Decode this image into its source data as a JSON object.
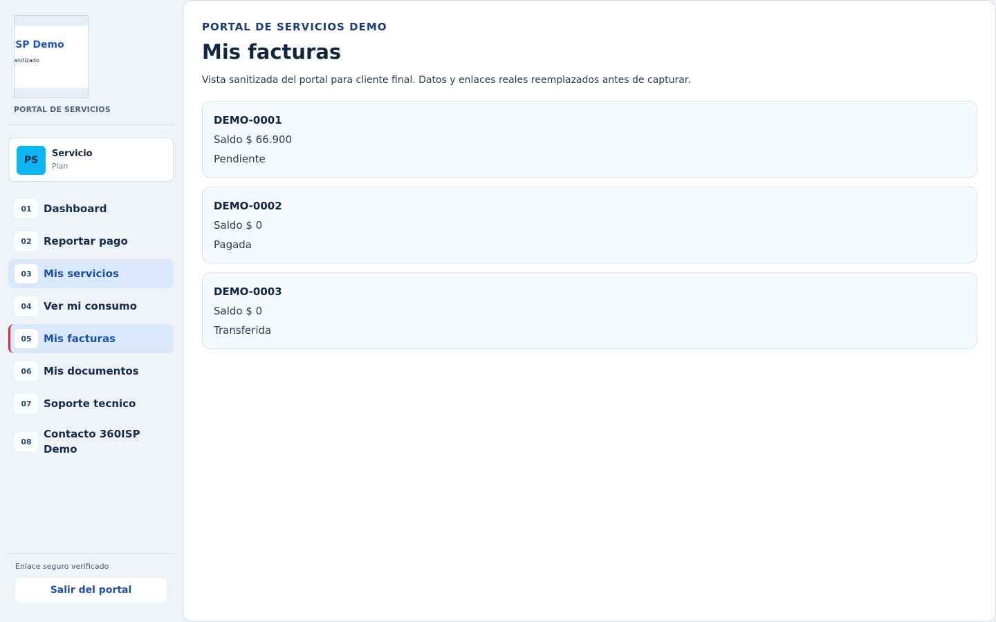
{
  "brand": {
    "logo_title": "ISP Demo",
    "logo_subtitle": "Sanitizado",
    "portal_label": "PORTAL DE SERVICIOS"
  },
  "service": {
    "avatar_initials": "PS",
    "name": "Servicio",
    "plan": "Plan"
  },
  "nav": {
    "items": [
      {
        "num": "01",
        "label": "Dashboard"
      },
      {
        "num": "02",
        "label": "Reportar pago"
      },
      {
        "num": "03",
        "label": "Mis servicios"
      },
      {
        "num": "04",
        "label": "Ver mi consumo"
      },
      {
        "num": "05",
        "label": "Mis facturas"
      },
      {
        "num": "06",
        "label": "Mis documentos"
      },
      {
        "num": "07",
        "label": "Soporte tecnico"
      },
      {
        "num": "08",
        "label": "Contacto 360ISP Demo"
      }
    ]
  },
  "footer": {
    "secure_text": "Enlace seguro verificado",
    "exit_label": "Salir del portal"
  },
  "main": {
    "eyebrow": "PORTAL DE SERVICIOS DEMO",
    "title": "Mis facturas",
    "description": "Vista sanitizada del portal para cliente final. Datos y enlaces reales reemplazados antes de capturar.",
    "invoices": [
      {
        "id": "DEMO-0001",
        "balance": "Saldo $ 66.900",
        "status": "Pendiente"
      },
      {
        "id": "DEMO-0002",
        "balance": "Saldo $ 0",
        "status": "Pagada"
      },
      {
        "id": "DEMO-0003",
        "balance": "Saldo $ 0",
        "status": "Transferida"
      }
    ]
  },
  "colors": {
    "accent": "#1d4fa8",
    "avatar": "#0db6f3",
    "active_bg": "#d9e9fb",
    "current_marker": "#d12a3a"
  }
}
